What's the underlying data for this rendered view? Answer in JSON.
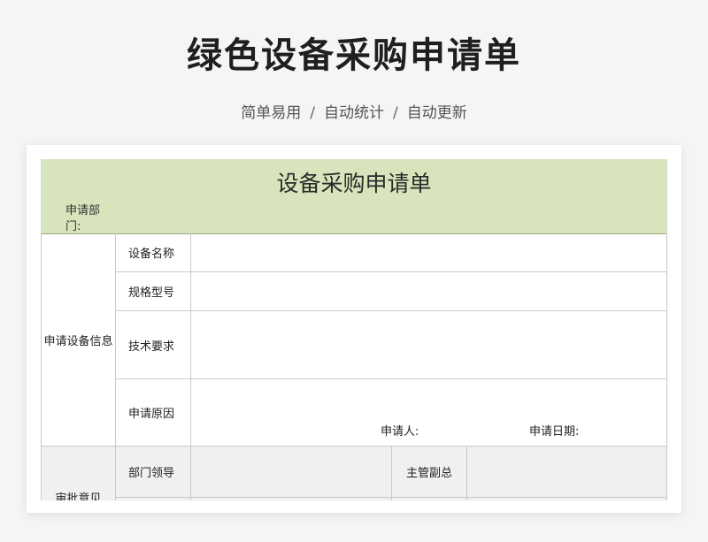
{
  "page": {
    "title": "绿色设备采购申请单",
    "tagline": [
      "简单易用",
      "自动统计",
      "自动更新"
    ],
    "separator": "/"
  },
  "form": {
    "title": "设备采购申请单",
    "dept_label": "申请部门:",
    "section_equipment": "申请设备信息",
    "fields": {
      "name": "设备名称",
      "model": "规格型号",
      "tech": "技术要求",
      "reason": "申请原因"
    },
    "applicant_label": "申请人:",
    "apply_date_label": "申请日期:",
    "section_approval": "审批意见",
    "approval": {
      "dept_leader": "部门领导",
      "vice_manager": "主管副总"
    }
  },
  "colors": {
    "header_band": "#d8e4bc",
    "approval_bg": "#f0f0f0",
    "grid_line": "#c9c9c9"
  }
}
